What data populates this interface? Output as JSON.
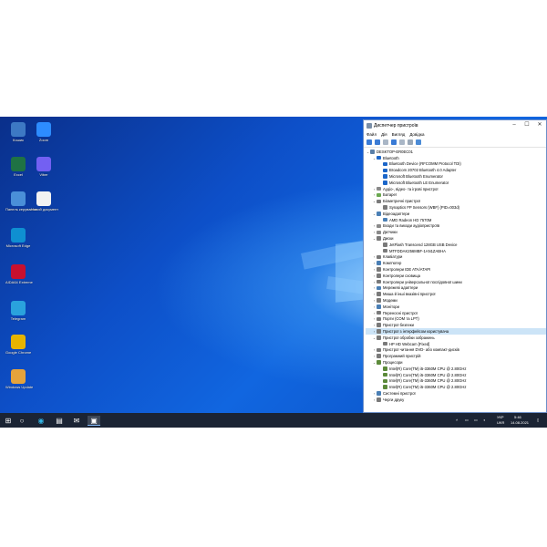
{
  "desktop": {
    "icons": [
      {
        "label": "Кошик",
        "icon": "recycle-bin-icon",
        "color": "#3d79c4"
      },
      {
        "label": "Zoom",
        "icon": "zoom-icon",
        "color": "#2d8cff"
      },
      {
        "label": "Excel",
        "icon": "excel-icon",
        "color": "#1f7244"
      },
      {
        "label": "Viber",
        "icon": "viber-icon",
        "color": "#7360f2"
      },
      {
        "label": "Панель керування",
        "icon": "control-panel-icon",
        "color": "#4a8fd8"
      },
      {
        "label": "Новий документ",
        "icon": "document-icon",
        "color": "#f2f2f2"
      },
      {
        "label": "Microsoft Edge",
        "icon": "edge-icon",
        "color": "#0f8fd1"
      },
      {
        "label": "AIDA64 Extreme",
        "icon": "aida64-icon",
        "color": "#c8102e"
      },
      {
        "label": "Telegram",
        "icon": "telegram-icon",
        "color": "#2aa2dd"
      },
      {
        "label": "Google Chrome",
        "icon": "chrome-icon",
        "color": "#e6b400"
      },
      {
        "label": "Windows Update",
        "icon": "update-icon",
        "color": "#e5a33b"
      }
    ]
  },
  "window": {
    "title": "Диспетчер пристроїв",
    "menu": [
      "Файл",
      "Дія",
      "Вигляд",
      "Довідка"
    ],
    "tree": [
      {
        "text": "DESKTOP-ER0EC01",
        "level": 0,
        "arrow": "v",
        "color": "#5a7fa8"
      },
      {
        "text": "Bluetooth",
        "level": 1,
        "arrow": "v",
        "color": "#1c66c9"
      },
      {
        "text": "Bluetooth Device (RFCOMM Protocol TDI)",
        "level": 2,
        "arrow": "",
        "color": "#1c66c9"
      },
      {
        "text": "Broadcom 20702 Bluetooth 4.0 Adapter",
        "level": 2,
        "arrow": "",
        "color": "#1c66c9"
      },
      {
        "text": "Microsoft Bluetooth Enumerator",
        "level": 2,
        "arrow": "",
        "color": "#1c66c9"
      },
      {
        "text": "Microsoft Bluetooth LE Enumerator",
        "level": 2,
        "arrow": "",
        "color": "#1c66c9"
      },
      {
        "text": "Аудіо-, відео- та ігрові пристрої",
        "level": 1,
        "arrow": ">",
        "color": "#8a8a8a"
      },
      {
        "text": "Батареї",
        "level": 1,
        "arrow": ">",
        "color": "#6aa84f"
      },
      {
        "text": "Біометричні пристрої",
        "level": 1,
        "arrow": "v",
        "color": "#7a7a7a"
      },
      {
        "text": "Synaptics FP Sensors (WBF) (PID=003d)",
        "level": 2,
        "arrow": "",
        "color": "#7a7a7a"
      },
      {
        "text": "Відеоадаптери",
        "level": 1,
        "arrow": "v",
        "color": "#4a7fb5"
      },
      {
        "text": "AMD Radeon HD 7570M",
        "level": 2,
        "arrow": "",
        "color": "#4a7fb5"
      },
      {
        "text": "Входи та виходи аудіопристроїв",
        "level": 1,
        "arrow": ">",
        "color": "#8a8a8a"
      },
      {
        "text": "Датчики",
        "level": 1,
        "arrow": ">",
        "color": "#8a8a8a"
      },
      {
        "text": "Диски",
        "level": 1,
        "arrow": "v",
        "color": "#7a7a7a"
      },
      {
        "text": "JetFlash Transcend 128GB USB Device",
        "level": 2,
        "arrow": "",
        "color": "#7a7a7a"
      },
      {
        "text": "MTFDDAK256MBF-1AN1ZABHA",
        "level": 2,
        "arrow": "",
        "color": "#7a7a7a"
      },
      {
        "text": "Клавіатури",
        "level": 1,
        "arrow": ">",
        "color": "#7a7a7a"
      },
      {
        "text": "Комп'ютер",
        "level": 1,
        "arrow": ">",
        "color": "#4a7fb5"
      },
      {
        "text": "Контролери IDE ATA/ATAPI",
        "level": 1,
        "arrow": ">",
        "color": "#7a7a7a"
      },
      {
        "text": "Контролери сховища",
        "level": 1,
        "arrow": ">",
        "color": "#7a7a7a"
      },
      {
        "text": "Контролери універсальної послідовної шини",
        "level": 1,
        "arrow": ">",
        "color": "#7a7a7a"
      },
      {
        "text": "Мережеві адаптери",
        "level": 1,
        "arrow": ">",
        "color": "#4a7fb5"
      },
      {
        "text": "Миша й інші вказівні пристрої",
        "level": 1,
        "arrow": ">",
        "color": "#7a7a7a"
      },
      {
        "text": "Модеми",
        "level": 1,
        "arrow": ">",
        "color": "#7a7a7a"
      },
      {
        "text": "Монітори",
        "level": 1,
        "arrow": ">",
        "color": "#4a7fb5"
      },
      {
        "text": "Переносні пристрої",
        "level": 1,
        "arrow": ">",
        "color": "#7a7a7a"
      },
      {
        "text": "Порти (COM та LPT)",
        "level": 1,
        "arrow": ">",
        "color": "#7a7a7a"
      },
      {
        "text": "Пристрої безпеки",
        "level": 1,
        "arrow": ">",
        "color": "#7a7a7a"
      },
      {
        "text": "Пристрої з інтерфейсом користувача",
        "level": 1,
        "arrow": ">",
        "color": "#7a7a7a",
        "selected": true
      },
      {
        "text": "Пристрої обробки зображень",
        "level": 1,
        "arrow": "v",
        "color": "#7a7a7a"
      },
      {
        "text": "HP HD Webcam [Fixed]",
        "level": 2,
        "arrow": "",
        "color": "#7a7a7a"
      },
      {
        "text": "Пристрої читання DVD- або компакт-дисків",
        "level": 1,
        "arrow": ">",
        "color": "#7a7a7a"
      },
      {
        "text": "Програмний пристрій",
        "level": 1,
        "arrow": ">",
        "color": "#7a7a7a"
      },
      {
        "text": "Процесори",
        "level": 1,
        "arrow": "v",
        "color": "#5c8a3a"
      },
      {
        "text": "Intel(R) Core(TM) i5-3360M CPU @ 2.80GHz",
        "level": 2,
        "arrow": "",
        "color": "#5c8a3a"
      },
      {
        "text": "Intel(R) Core(TM) i5-3360M CPU @ 2.80GHz",
        "level": 2,
        "arrow": "",
        "color": "#5c8a3a"
      },
      {
        "text": "Intel(R) Core(TM) i5-3360M CPU @ 2.80GHz",
        "level": 2,
        "arrow": "",
        "color": "#5c8a3a"
      },
      {
        "text": "Intel(R) Core(TM) i5-3360M CPU @ 2.80GHz",
        "level": 2,
        "arrow": "",
        "color": "#5c8a3a"
      },
      {
        "text": "Системні пристрої",
        "level": 1,
        "arrow": ">",
        "color": "#4a7fb5"
      },
      {
        "text": "Черги друку",
        "level": 1,
        "arrow": ">",
        "color": "#7a7a7a"
      }
    ]
  },
  "taskbar": {
    "lang_top": "УКР",
    "lang_bottom": "UKR",
    "time": "5:46",
    "date": "14.08.2021",
    "items": [
      "start-icon",
      "search-icon",
      "edge-icon",
      "store-icon",
      "mail-icon",
      "device-manager-icon"
    ]
  },
  "colors": {
    "accent": "#0078d7",
    "taskbar": "#1b2434"
  }
}
